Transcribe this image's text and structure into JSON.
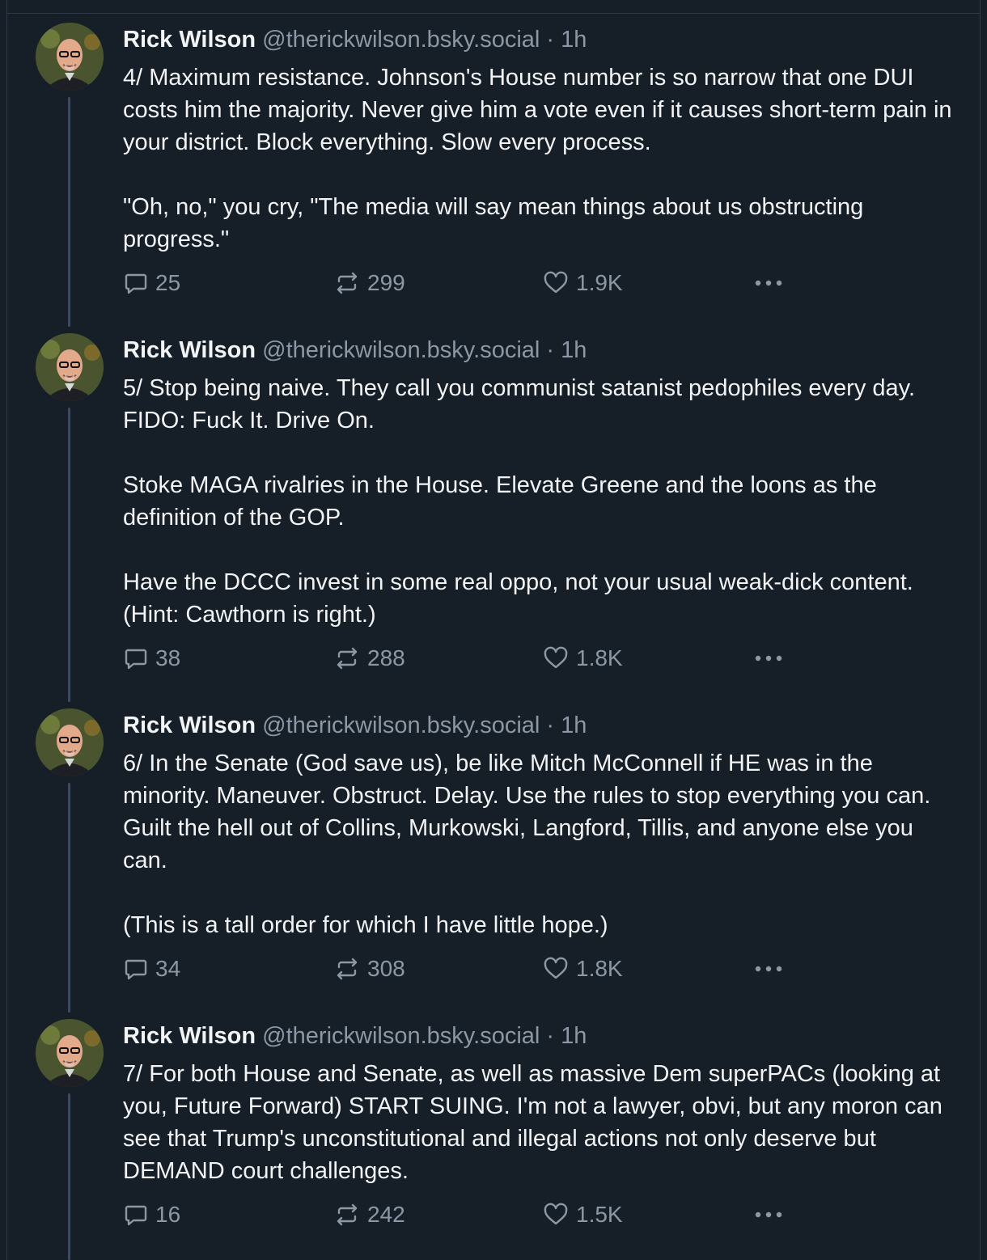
{
  "colors": {
    "background": "#161e27",
    "text": "#f1f3f5",
    "muted": "#8b98a5",
    "thread_line": "#3b4a5c"
  },
  "posts": [
    {
      "author_name": "Rick Wilson",
      "handle": "@therickwilson.bsky.social",
      "separator": "·",
      "time": "1h",
      "paragraphs": [
        "4/ Maximum resistance. Johnson's House number is so narrow that one DUI costs him the majority. Never give him a vote even if it causes short-term pain in your district. Block everything. Slow every process.",
        "\"Oh, no,\" you cry, \"The media will say mean things about us obstructing progress.\""
      ],
      "replies": "25",
      "reposts": "299",
      "likes": "1.9K"
    },
    {
      "author_name": "Rick Wilson",
      "handle": "@therickwilson.bsky.social",
      "separator": "·",
      "time": "1h",
      "paragraphs": [
        "5/ Stop being naive. They call you communist satanist pedophiles every day. FIDO: Fuck It. Drive On.",
        "Stoke MAGA rivalries in the House. Elevate Greene and the loons as the definition of the GOP.",
        "Have the DCCC invest in some real oppo, not your usual weak-dick content. (Hint: Cawthorn is right.)"
      ],
      "replies": "38",
      "reposts": "288",
      "likes": "1.8K"
    },
    {
      "author_name": "Rick Wilson",
      "handle": "@therickwilson.bsky.social",
      "separator": "·",
      "time": "1h",
      "paragraphs": [
        "6/ In the Senate (God save us), be like Mitch McConnell if HE was in the minority. Maneuver. Obstruct. Delay. Use the rules to stop everything you can. Guilt the hell out of Collins, Murkowski, Langford, Tillis, and anyone else you can.",
        "(This is a tall order for which I have little hope.)"
      ],
      "replies": "34",
      "reposts": "308",
      "likes": "1.8K"
    },
    {
      "author_name": "Rick Wilson",
      "handle": "@therickwilson.bsky.social",
      "separator": "·",
      "time": "1h",
      "paragraphs": [
        "7/ For both House and Senate, as well as massive Dem superPACs (looking at you, Future Forward) START SUING. I'm not a lawyer, obvi, but any moron can see that Trump's unconstitutional and illegal actions not only deserve but DEMAND court challenges."
      ],
      "replies": "16",
      "reposts": "242",
      "likes": "1.5K"
    }
  ]
}
